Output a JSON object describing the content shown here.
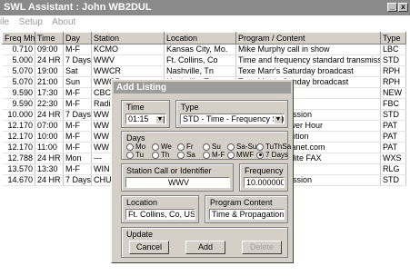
{
  "window": {
    "title": "SWL Assistant : John WB2DUL",
    "minimize_glyph": "_",
    "close_glyph": "x"
  },
  "menu": [
    "ile",
    "Setup",
    "About"
  ],
  "grid": {
    "headers": [
      "Freq Mhz",
      "Time",
      "Day",
      "Station",
      "Location",
      "Program / Content",
      "Type"
    ],
    "rows": [
      [
        "0.710",
        "09:00",
        "M-F",
        "KCMO",
        "Kansas City, Mo.",
        "Mike Murphy call in show",
        "LBC"
      ],
      [
        "5.000",
        "24 HR",
        "7 Days",
        "WWV",
        "Ft. Collins, Co",
        "Time and frequency standard transmission",
        "STD"
      ],
      [
        "5.070",
        "19:00",
        "Sat",
        "WWCR",
        "Nashville, Tn",
        "Texe Marr's Saturday broadcast",
        "RPH"
      ],
      [
        "5.070",
        "21:00",
        "Sun",
        "WWCR",
        "Nashville, Tn",
        "Texe Marr's Sunday broadcast",
        "RPH"
      ],
      [
        "9.590",
        "17:30",
        "M-F",
        "CBC",
        "",
        "nada",
        "NEW"
      ],
      [
        "9.590",
        "22:30",
        "M-F",
        "Radi",
        "",
        "vice",
        "FBC"
      ],
      [
        "10.000",
        "24 HR",
        "7 Days",
        "WW",
        "",
        "andard transmission",
        "STD"
      ],
      [
        "12.170",
        "07:00",
        "M-F",
        "WW",
        "",
        "VonKleist - Power Hour",
        "PAT"
      ],
      [
        "12.170",
        "10:00",
        "M-F",
        "WW",
        "",
        "ion Sense Coalition",
        "PAT"
      ],
      [
        "12.170",
        "11:00",
        "M-F",
        "WW",
        "",
        "com - PrisonPlanet.com",
        "PAT"
      ],
      [
        "12.788",
        "24 HR",
        "Mon",
        "---",
        "",
        "ports and Satellite FAX",
        "WXS"
      ],
      [
        "13.570",
        "13:30",
        "M-F",
        "WIN",
        "",
        "nner Ministry",
        "RLG"
      ],
      [
        "14.670",
        "24 HR",
        "7 Days",
        "CHU",
        "",
        "andard transmission",
        "STD"
      ]
    ]
  },
  "dialog": {
    "title": "Add Listing",
    "time": {
      "label": "Time",
      "value": "01:15"
    },
    "type": {
      "label": "Type",
      "value": "STD - Time - Frequency Standar"
    },
    "days": {
      "label": "Days",
      "options": [
        "Mo",
        "We",
        "Fr",
        "Su",
        "Sa-Su",
        "TuThSa",
        "Tu",
        "Th",
        "Sa",
        "M-F",
        "MWF",
        "7 Days"
      ],
      "selected": "7 Days"
    },
    "station": {
      "label": "Station Call or Identifier",
      "value": "WWV"
    },
    "frequency": {
      "label": "Frequency",
      "value": "10.00000000"
    },
    "location": {
      "label": "Location",
      "value": "Ft. Collins, Co, USA"
    },
    "program": {
      "label": "Program Content",
      "value": "Time & Propagation Info"
    },
    "update": {
      "label": "Update",
      "cancel": "Cancel",
      "add": "Add",
      "delete": "Delete"
    },
    "dropdown_glyph": "▼"
  }
}
